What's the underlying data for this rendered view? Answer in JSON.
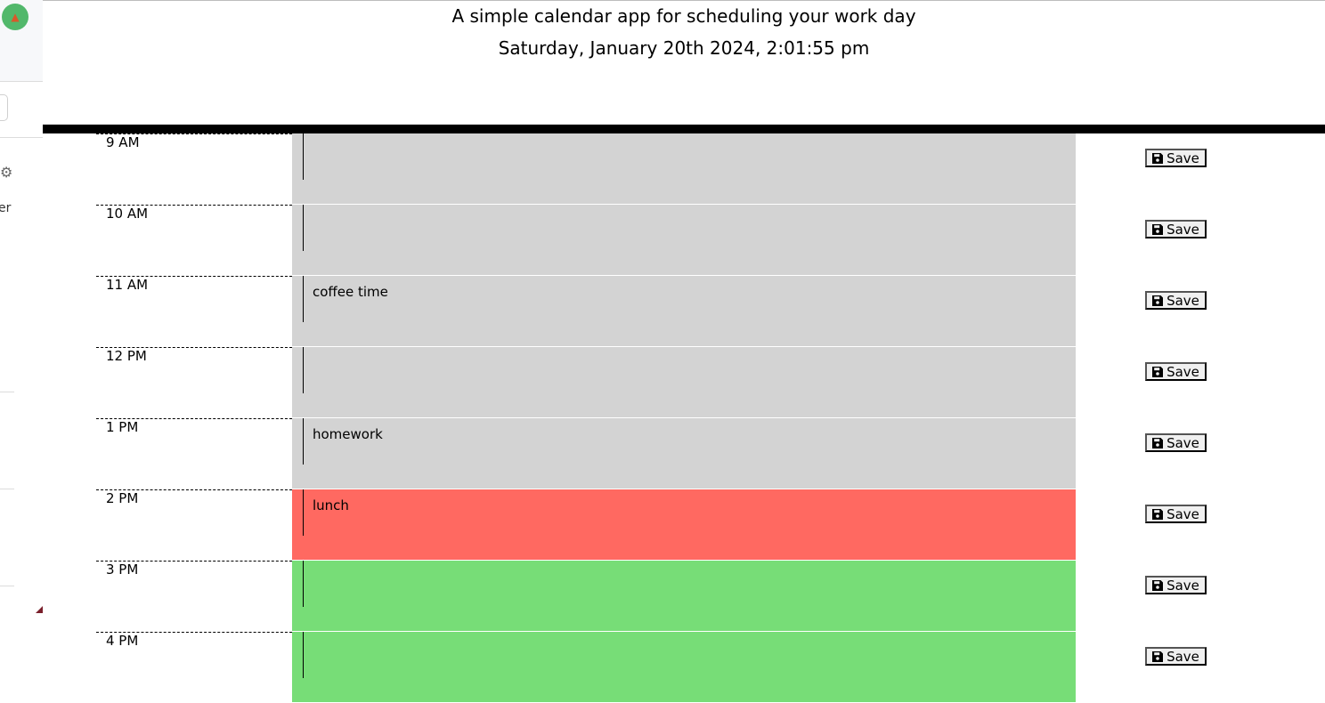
{
  "sidebar": {
    "partial_text": "er"
  },
  "header": {
    "title": "A simple calendar app for scheduling your work day",
    "date": "Saturday, January 20th 2024, 2:01:55 pm"
  },
  "colors": {
    "past": "#d3d3d3",
    "present": "#ff6961",
    "future": "#77dd77",
    "header_bar": "#000000"
  },
  "schedule": [
    {
      "hour": "9 AM",
      "text": "",
      "status": "past",
      "save_label": "Save"
    },
    {
      "hour": "10 AM",
      "text": "",
      "status": "past",
      "save_label": "Save"
    },
    {
      "hour": "11 AM",
      "text": "coffee time",
      "status": "past",
      "save_label": "Save"
    },
    {
      "hour": "12 PM",
      "text": "",
      "status": "past",
      "save_label": "Save"
    },
    {
      "hour": "1 PM",
      "text": "homework",
      "status": "past",
      "save_label": "Save"
    },
    {
      "hour": "2 PM",
      "text": "lunch",
      "status": "present",
      "save_label": "Save"
    },
    {
      "hour": "3 PM",
      "text": "",
      "status": "future",
      "save_label": "Save"
    },
    {
      "hour": "4 PM",
      "text": "",
      "status": "future",
      "save_label": "Save"
    }
  ]
}
